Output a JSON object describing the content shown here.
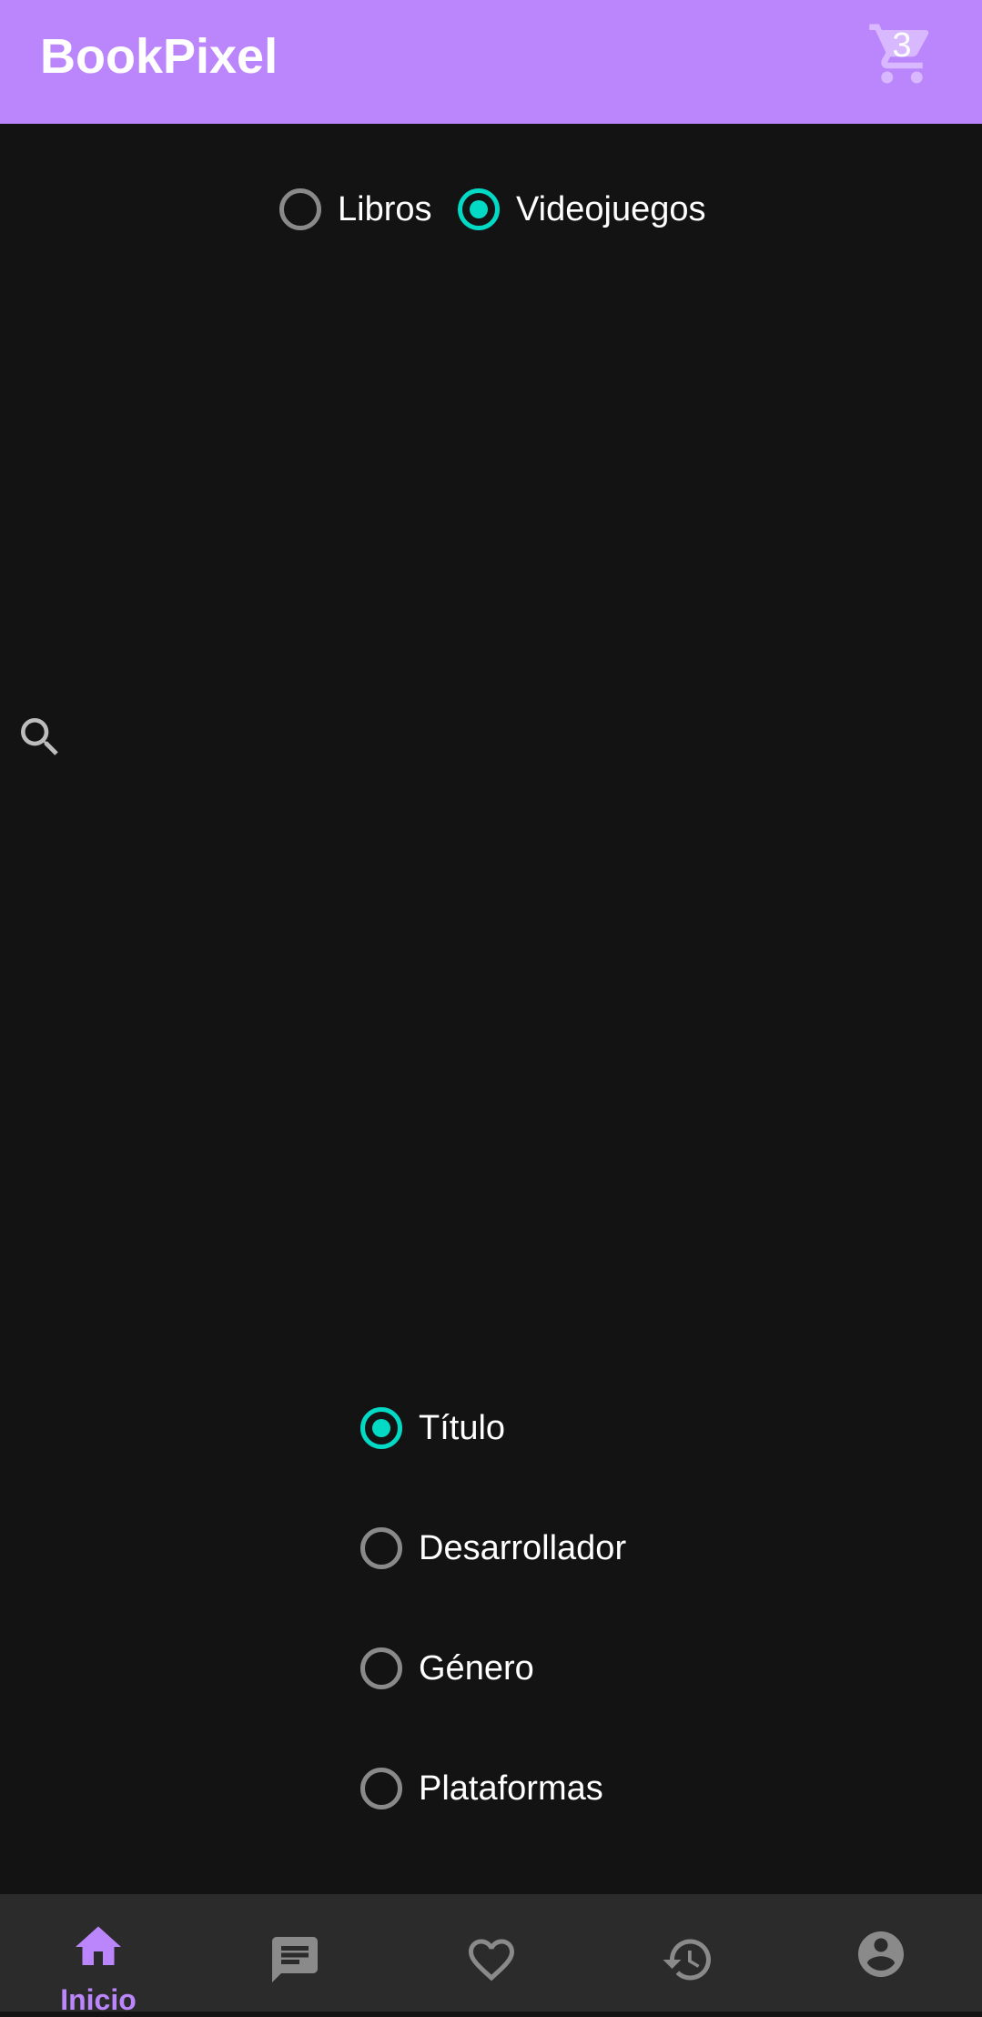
{
  "app": {
    "title": "BookPixel",
    "cart_count": "3"
  },
  "category": {
    "options": [
      {
        "label": "Libros",
        "checked": false
      },
      {
        "label": "Videojuegos",
        "checked": true
      }
    ]
  },
  "search_icon": "search-icon",
  "filters": {
    "options": [
      {
        "label": "Título",
        "checked": true
      },
      {
        "label": "Desarrollador",
        "checked": false
      },
      {
        "label": "Género",
        "checked": false
      },
      {
        "label": "Plataformas",
        "checked": false
      }
    ]
  },
  "bottom_nav": {
    "items": [
      {
        "icon": "home-icon",
        "label": "Inicio",
        "active": true
      },
      {
        "icon": "chat-icon",
        "label": "",
        "active": false
      },
      {
        "icon": "heart-icon",
        "label": "",
        "active": false
      },
      {
        "icon": "history-icon",
        "label": "",
        "active": false
      },
      {
        "icon": "account-icon",
        "label": "",
        "active": false
      }
    ]
  },
  "colors": {
    "primary": "#bb86fc",
    "accent": "#03dac5",
    "background": "#131313",
    "nav_background": "#2b2b2b",
    "inactive_icon": "#8a8a8a"
  }
}
